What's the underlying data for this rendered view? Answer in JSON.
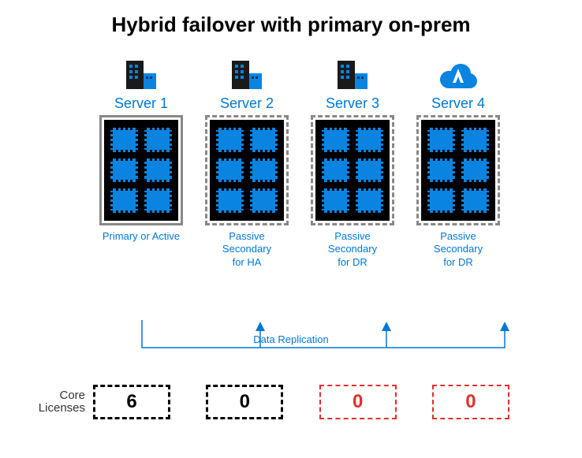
{
  "title": "Hybrid failover with primary on-prem",
  "servers": [
    {
      "name": "Server 1",
      "icon": "building",
      "box_style": "solid",
      "role": "Primary or Active"
    },
    {
      "name": "Server 2",
      "icon": "building",
      "box_style": "dash",
      "role": "Passive\nSecondary\nfor HA"
    },
    {
      "name": "Server 3",
      "icon": "building",
      "box_style": "dash",
      "role": "Passive\nSecondary\nfor DR"
    },
    {
      "name": "Server 4",
      "icon": "cloud",
      "box_style": "dash",
      "role": "Passive\nSecondary\nfor DR"
    }
  ],
  "replication_label": "Data Replication",
  "licenses_label": "Core\nLicenses",
  "licenses": [
    {
      "value": "6",
      "style": "black"
    },
    {
      "value": "0",
      "style": "black"
    },
    {
      "value": "0",
      "style": "red"
    },
    {
      "value": "0",
      "style": "red"
    }
  ],
  "colors": {
    "azure_blue": "#0078d4",
    "chip_blue": "#0a84e0",
    "red": "#e03030"
  }
}
